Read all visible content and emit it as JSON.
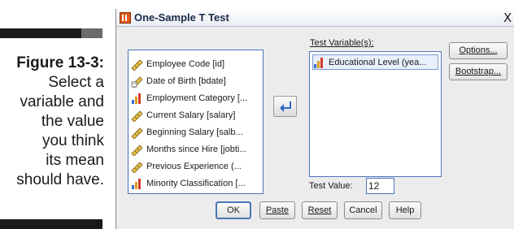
{
  "caption": {
    "figure": "Figure 13-3:",
    "lines": [
      "Select a",
      "variable and",
      "the value",
      "you think",
      "its mean",
      "should have."
    ]
  },
  "dialog": {
    "title": "One-Sample T Test",
    "close": "X",
    "source_variables": [
      {
        "label": "Employee Code [id]",
        "icon": "scale-ruler-icon"
      },
      {
        "label": "Date of Birth [bdate]",
        "icon": "date-scale-icon"
      },
      {
        "label": "Employment Category [...",
        "icon": "ordinal-bars-icon"
      },
      {
        "label": "Current Salary [salary]",
        "icon": "scale-ruler-icon"
      },
      {
        "label": "Beginning Salary [salb...",
        "icon": "scale-ruler-icon"
      },
      {
        "label": "Months since Hire [jobti...",
        "icon": "scale-ruler-icon"
      },
      {
        "label": "Previous Experience (...",
        "icon": "scale-ruler-icon"
      },
      {
        "label": "Minority Classification [...",
        "icon": "ordinal-bars-icon"
      }
    ],
    "test_variables_label": "Test Variable(s):",
    "test_variables": [
      {
        "label": "Educational Level (yea...",
        "icon": "ordinal-bars-icon"
      }
    ],
    "options_label": "Options...",
    "bootstrap_label": "Bootstrap...",
    "test_value_label": "Test Value:",
    "test_value": "12",
    "buttons": {
      "ok": "OK",
      "paste": "Paste",
      "reset": "Reset",
      "cancel": "Cancel",
      "help": "Help"
    },
    "colors": {
      "list_border": "#4a76b8",
      "arrow_blue": "#2f67c8",
      "bars_red": "#d63a2a"
    }
  }
}
